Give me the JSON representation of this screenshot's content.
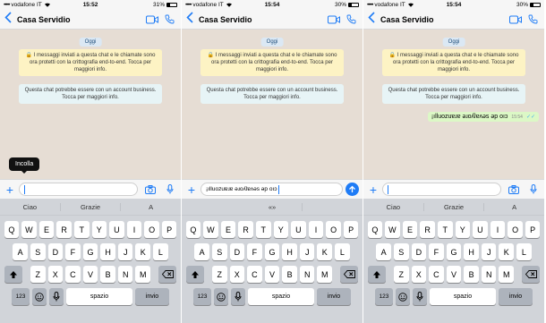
{
  "panels": [
    {
      "status": {
        "carrier": "vodafone IT",
        "time": "15:52",
        "battery": "31%",
        "battery_level": 0.31
      },
      "chat_title": "Casa Servidio",
      "date_chip": "Oggi",
      "system_notice": "🔒 I messaggi inviati a questa chat e le chiamate sono ora protetti con la crittografia end-to-end. Tocca per maggiori info.",
      "business_notice": "Questa chat potrebbe essere con un account business. Tocca per maggiori info.",
      "tooltip": "Incolla",
      "input_value": "",
      "suggestions": [
        "Ciao",
        "Grazie",
        "A"
      ]
    },
    {
      "status": {
        "carrier": "vodafone IT",
        "time": "15:54",
        "battery": "30%",
        "battery_level": 0.3
      },
      "chat_title": "Casa Servidio",
      "date_chip": "Oggi",
      "system_notice": "🔒 I messaggi inviati a questa chat e le chiamate sono ora protetti con la crittografia end-to-end. Tocca per maggiori info.",
      "business_notice": "Questa chat potrebbe essere con un account business. Tocca per maggiori info.",
      "input_value": "¡ılluozuɐɹɐ ǝɹoʎlɐʌǝs ǝp oıɔ",
      "suggestions": [
        "",
        "«»",
        ""
      ]
    },
    {
      "status": {
        "carrier": "vodafone IT",
        "time": "15:54",
        "battery": "30%",
        "battery_level": 0.3
      },
      "chat_title": "Casa Servidio",
      "date_chip": "Oggi",
      "system_notice": "🔒 I messaggi inviati a questa chat e le chiamate sono ora protetti con la crittografia end-to-end. Tocca per maggiori info.",
      "business_notice": "Questa chat potrebbe essere con un account business. Tocca per maggiori info.",
      "sent_message": "¡ılluozuɐɹɐ ǝɹoʎlɐʌǝs ǝp oıɔ",
      "sent_time": "15:54",
      "input_value": "",
      "suggestions": [
        "Ciao",
        "Grazie",
        "A"
      ]
    }
  ],
  "keyboard": {
    "row1": [
      "Q",
      "W",
      "E",
      "R",
      "T",
      "Y",
      "U",
      "I",
      "O",
      "P"
    ],
    "row2": [
      "A",
      "S",
      "D",
      "F",
      "G",
      "H",
      "J",
      "K",
      "L"
    ],
    "row3": [
      "Z",
      "X",
      "C",
      "V",
      "B",
      "N",
      "M"
    ],
    "key_123": "123",
    "space": "spazio",
    "enter": "invio"
  },
  "colors": {
    "accent": "#1f7cf6",
    "chat_bg": "#e6ddd4",
    "notice_yellow": "#fdf3c4",
    "notice_biz": "#e7f4f6",
    "outgoing": "#dcf8c6"
  },
  "icons": [
    "back-icon",
    "video-call-icon",
    "phone-icon",
    "plus-icon",
    "camera-icon",
    "microphone-icon",
    "send-icon",
    "shift-icon",
    "delete-icon",
    "emoji-icon",
    "wifi-icon",
    "lock-icon"
  ]
}
